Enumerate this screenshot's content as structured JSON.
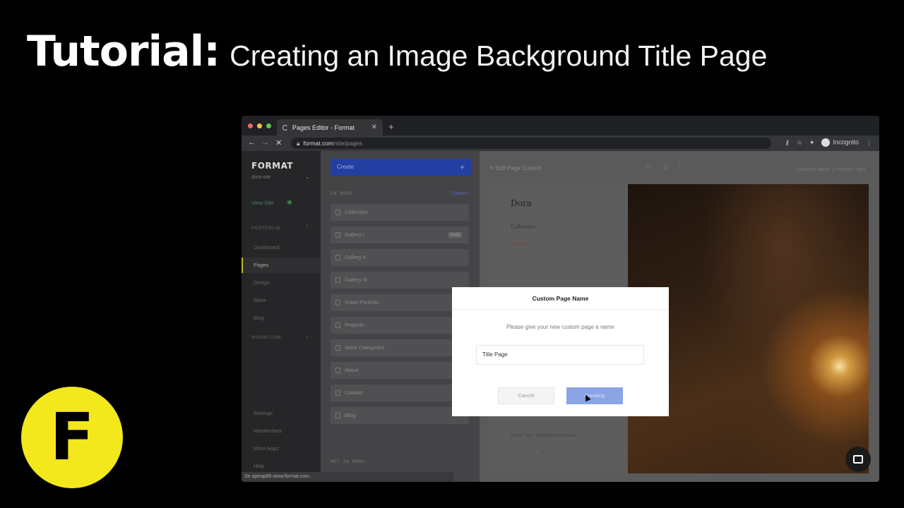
{
  "header": {
    "title_bold": "Tutorial:",
    "title_light": "Creating an Image Background Title Page"
  },
  "logo": {
    "letter": "F",
    "color": "#f2e81c"
  },
  "browser": {
    "tab_title": "Pages Editor - Format",
    "url_domain": "format.com",
    "url_path": "/site/pages",
    "profile_label": "Incognito",
    "status_text": "Se aptrap89 www.format.com..."
  },
  "sidebar": {
    "brand": "FORMAT",
    "site_name": "dora-site",
    "view_site": "View Site",
    "portfolio_section": "PORTFOLIO",
    "workflow_section": "WORKFLOW",
    "items": [
      "Dashboard",
      "Pages",
      "Design",
      "Store",
      "Blog"
    ],
    "bottom_items": [
      "Settings",
      "Masterclass",
      "More Apps",
      "Help"
    ]
  },
  "pages_panel": {
    "create_label": "Create",
    "in_menu_label": "IN MENU",
    "options_label": "Options",
    "pages": [
      "Collection",
      "Gallery I",
      "Gallery II",
      "Gallery III",
      "Video Portfolio",
      "Projects",
      "Store Categories",
      "About",
      "Contact",
      "Blog"
    ],
    "home_badge": "HOME",
    "not_in_menu_label": "NOT IN MENU"
  },
  "editor": {
    "edit_label": "Edit Page Content",
    "updated": "Updated about 2 minutes ago",
    "preview_title": "Dora",
    "preview_links": [
      "Collection",
      "Gallery I"
    ],
    "footer_text": "Footer Text - Copyright information",
    "social_icons": "♥ f ✉ ···"
  },
  "modal": {
    "title": "Custom Page Name",
    "prompt": "Please give your new custom page a name",
    "input_value": "Title Page",
    "cancel_label": "Cancel",
    "create_label": "Creating"
  }
}
